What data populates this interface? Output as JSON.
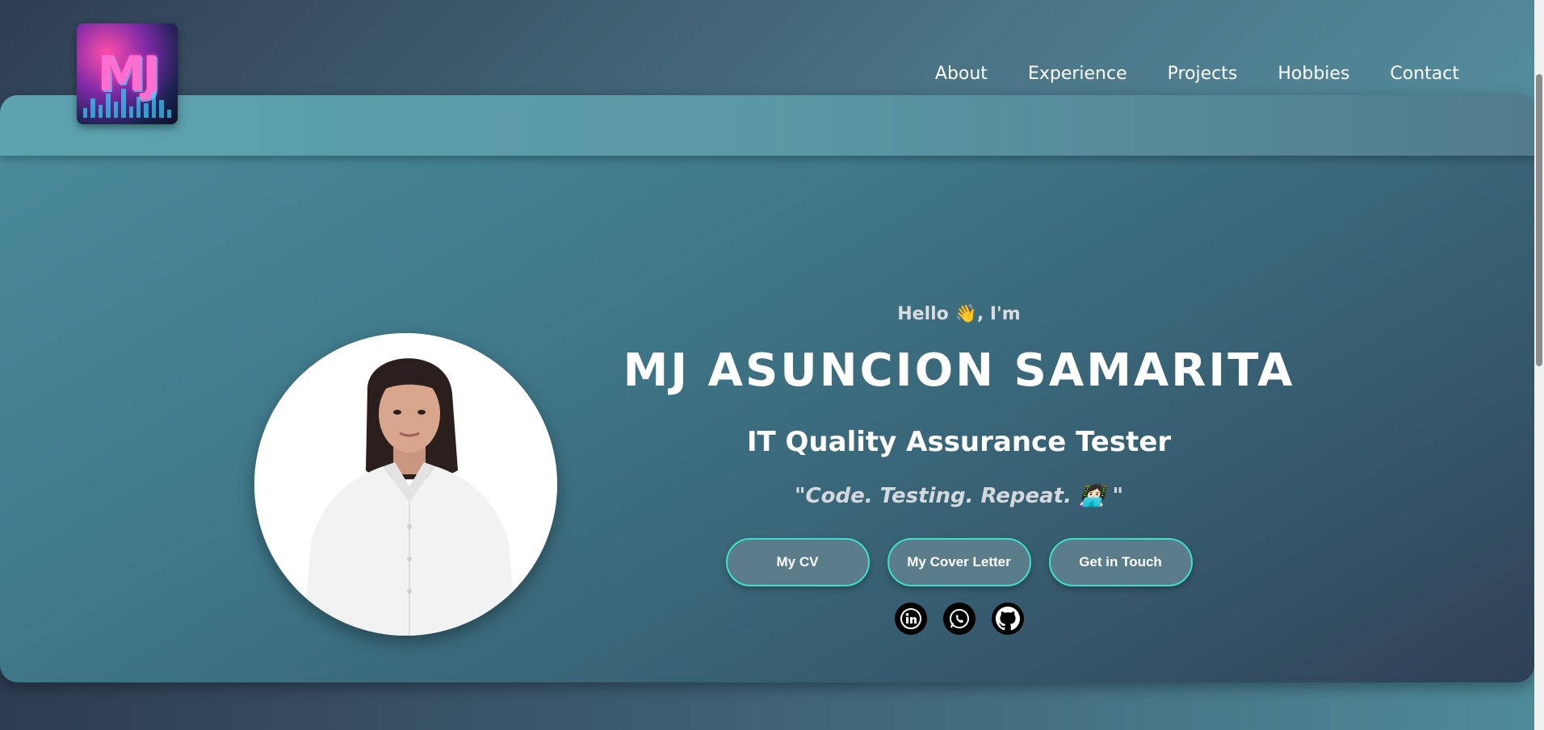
{
  "nav": {
    "items": [
      {
        "label": "About"
      },
      {
        "label": "Experience"
      },
      {
        "label": "Projects"
      },
      {
        "label": "Hobbies"
      },
      {
        "label": "Contact"
      }
    ]
  },
  "logo": {
    "text": "MJ"
  },
  "hero": {
    "greeting": "Hello 👋, I'm",
    "name": "MJ ASUNCION SAMARITA",
    "role": "IT Quality Assurance Tester",
    "tagline": "\"Code. Testing. Repeat. 👩🏻‍💻 \"",
    "buttons": {
      "cv": "My CV",
      "cover_letter": "My Cover Letter",
      "contact": "Get in Touch"
    },
    "socials": [
      {
        "icon": "linkedin-icon"
      },
      {
        "icon": "whatsapp-icon"
      },
      {
        "icon": "github-icon"
      }
    ]
  },
  "colors": {
    "accent": "#3de0c8",
    "button_bg": "#5b7d8a"
  }
}
